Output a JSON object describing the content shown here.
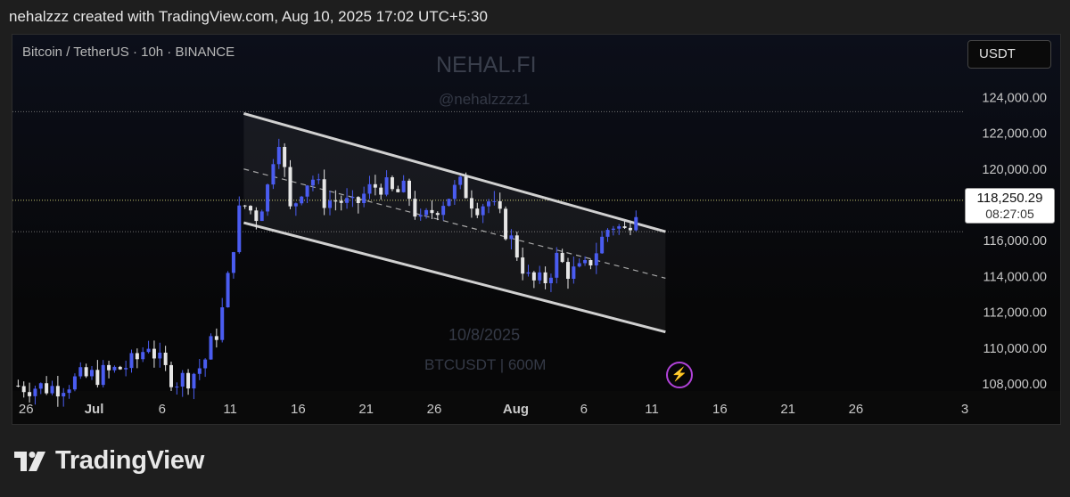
{
  "header": {
    "text": "nehalzzz created with TradingView.com, Aug 10, 2025 17:02 UTC+5:30"
  },
  "chart_header": {
    "symbol": "Bitcoin / TetherUS · 10h · BINANCE",
    "currency": "USDT"
  },
  "watermark": {
    "title": "NEHAL.FI",
    "handle": "@nehalzzzz1",
    "date": "10/8/2025",
    "pair": "BTCUSDT | 600M"
  },
  "price_label": {
    "price": "118,250.29",
    "countdown": "08:27:05"
  },
  "footer": {
    "brand": "TradingView"
  },
  "icons": {
    "replay": "lightning-icon",
    "logo": "tradingview-logo-icon"
  },
  "colors": {
    "up": "#4a5cf0",
    "down": "#e6e6e6",
    "channel": "#d0d0d0",
    "background": "#070708"
  },
  "chart_data": {
    "type": "candlestick",
    "y_ticks": [
      124000,
      122000,
      120000,
      118000,
      116000,
      114000,
      112000,
      110000,
      108000
    ],
    "y_tick_labels": [
      "124,000.00",
      "122,000.00",
      "120,000.00",
      "",
      "116,000.00",
      "114,000.00",
      "112,000.00",
      "110,000.00",
      "108,000.00"
    ],
    "ylim": [
      107600,
      127500
    ],
    "x_tick_labels": [
      {
        "label": "26",
        "date": "2025-06-26"
      },
      {
        "label": "Jul",
        "date": "2025-07-01"
      },
      {
        "label": "6",
        "date": "2025-07-06"
      },
      {
        "label": "11",
        "date": "2025-07-11"
      },
      {
        "label": "16",
        "date": "2025-07-16"
      },
      {
        "label": "21",
        "date": "2025-07-21"
      },
      {
        "label": "26",
        "date": "2025-07-26"
      },
      {
        "label": "Aug",
        "date": "2025-08-01"
      },
      {
        "label": "6",
        "date": "2025-08-06"
      },
      {
        "label": "11",
        "date": "2025-08-11"
      },
      {
        "label": "16",
        "date": "2025-08-16"
      },
      {
        "label": "21",
        "date": "2025-08-21"
      },
      {
        "label": "26",
        "date": "2025-08-26"
      },
      {
        "label": "3",
        "date": "2025-09-03"
      }
    ],
    "xlim": [
      "2025-06-25",
      "2025-09-03"
    ],
    "last_price": 118250.29,
    "horizontal_levels": [
      123200,
      118250.29,
      116500
    ],
    "channel": {
      "start": "2025-07-12",
      "end": "2025-08-12",
      "upper": [
        123100,
        116500
      ],
      "middle": [
        120000,
        113900
      ],
      "lower": [
        117000,
        110900
      ]
    },
    "price_path": [
      [
        "2025-06-25",
        107900
      ],
      [
        "2025-06-28",
        107800
      ],
      [
        "2025-06-30",
        108300
      ],
      [
        "2025-07-02",
        108600
      ],
      [
        "2025-07-04",
        109200
      ],
      [
        "2025-07-05",
        110300
      ],
      [
        "2025-07-06",
        108900
      ],
      [
        "2025-07-07",
        108200
      ],
      [
        "2025-07-08",
        108400
      ],
      [
        "2025-07-09",
        109100
      ],
      [
        "2025-07-10",
        110900
      ],
      [
        "2025-07-10T12",
        112300
      ],
      [
        "2025-07-11",
        114500
      ],
      [
        "2025-07-11T12",
        117300
      ],
      [
        "2025-07-12",
        118000
      ],
      [
        "2025-07-13",
        117400
      ],
      [
        "2025-07-14",
        119500
      ],
      [
        "2025-07-14T10",
        122700
      ],
      [
        "2025-07-15",
        119800
      ],
      [
        "2025-07-15T12",
        117200
      ],
      [
        "2025-07-16",
        118800
      ],
      [
        "2025-07-17",
        119600
      ],
      [
        "2025-07-18",
        118200
      ],
      [
        "2025-07-19",
        118300
      ],
      [
        "2025-07-20",
        117800
      ],
      [
        "2025-07-21",
        118700
      ],
      [
        "2025-07-22",
        119200
      ],
      [
        "2025-07-23",
        118600
      ],
      [
        "2025-07-24",
        118800
      ],
      [
        "2025-07-25",
        116900
      ],
      [
        "2025-07-26",
        117800
      ],
      [
        "2025-07-27",
        118500
      ],
      [
        "2025-07-28",
        119100
      ],
      [
        "2025-07-29",
        118000
      ],
      [
        "2025-07-30",
        118200
      ],
      [
        "2025-07-31",
        117000
      ],
      [
        "2025-08-01",
        115500
      ],
      [
        "2025-08-02",
        113700
      ],
      [
        "2025-08-03",
        113600
      ],
      [
        "2025-08-04",
        115000
      ],
      [
        "2025-08-05",
        114200
      ],
      [
        "2025-08-06",
        114300
      ],
      [
        "2025-08-07",
        115600
      ],
      [
        "2025-08-08",
        117000
      ],
      [
        "2025-08-09",
        116500
      ],
      [
        "2025-08-10",
        118250
      ]
    ]
  }
}
